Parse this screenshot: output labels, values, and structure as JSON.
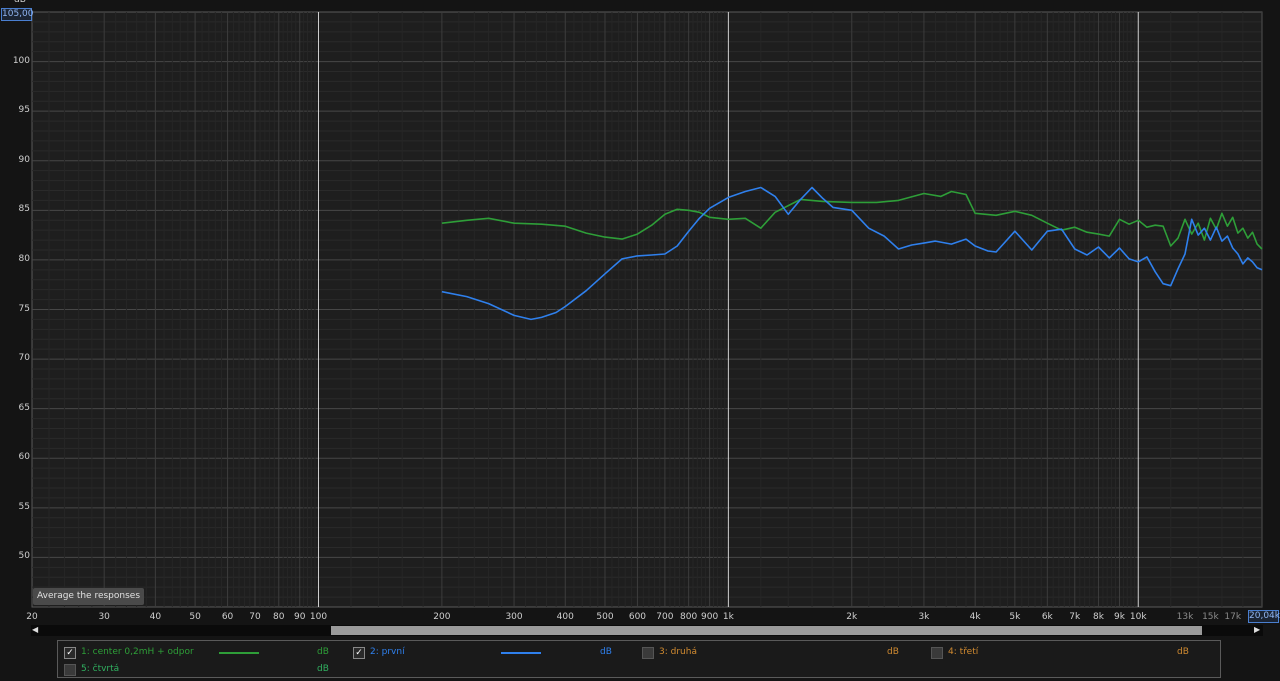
{
  "y_axis": {
    "unit": "dB",
    "max_value": "105,00",
    "tick_labels": [
      "100",
      "95",
      "90",
      "85",
      "80",
      "75",
      "70",
      "65",
      "60",
      "55",
      "50"
    ]
  },
  "x_axis": {
    "max_value": "20,04k",
    "tick_labels": [
      "20",
      "30",
      "40",
      "50",
      "60",
      "70",
      "80",
      "90",
      "100",
      "200",
      "300",
      "400",
      "500",
      "600",
      "700",
      "800",
      "900",
      "1k",
      "2k",
      "3k",
      "4k",
      "5k",
      "6k",
      "7k",
      "8k",
      "9k",
      "10k",
      "13k",
      "15k",
      "17k"
    ]
  },
  "buttons": {
    "average_label": "Average the responses"
  },
  "legend": {
    "items": [
      {
        "label": "1: center 0,2mH + odpor",
        "unit": "dB",
        "checked": true,
        "color": "#2e9e38"
      },
      {
        "label": "2: první",
        "unit": "dB",
        "checked": true,
        "color": "#2f80ed"
      },
      {
        "label": "3: druhá",
        "unit": "dB",
        "checked": false,
        "color": "#d08a30"
      },
      {
        "label": "4: třetí",
        "unit": "dB",
        "checked": false,
        "color": "#d08a30"
      },
      {
        "label": "5: čtvrtá",
        "unit": "dB",
        "checked": false,
        "color": "#30b060"
      }
    ]
  },
  "chart_data": {
    "type": "line",
    "x_scale": "log",
    "xlim": [
      20,
      20040
    ],
    "ylim": [
      45,
      105
    ],
    "grid": true,
    "series": [
      {
        "name": "1: center 0,2mH + odpor",
        "color": "#2e9e38",
        "x": [
          200,
          230,
          260,
          300,
          350,
          400,
          450,
          500,
          550,
          600,
          650,
          700,
          750,
          800,
          850,
          900,
          1000,
          1100,
          1200,
          1300,
          1500,
          1700,
          2000,
          2300,
          2600,
          3000,
          3300,
          3500,
          3800,
          4000,
          4500,
          5000,
          5500,
          6000,
          6500,
          7000,
          7500,
          8000,
          8500,
          9000,
          9500,
          10000,
          10500,
          11000,
          11500,
          12000,
          12500,
          13000,
          13500,
          14000,
          14500,
          15000,
          15500,
          16000,
          16500,
          17000,
          17500,
          18000,
          18500,
          19000,
          19500,
          20040
        ],
        "y": [
          83.7,
          84.0,
          84.2,
          83.7,
          83.6,
          83.4,
          82.7,
          82.3,
          82.1,
          82.6,
          83.5,
          84.6,
          85.1,
          85.0,
          84.8,
          84.3,
          84.1,
          84.2,
          83.2,
          84.8,
          86.1,
          85.9,
          85.8,
          85.8,
          86.0,
          86.7,
          86.4,
          86.9,
          86.6,
          84.7,
          84.5,
          84.9,
          84.5,
          83.7,
          83.0,
          83.3,
          82.8,
          82.6,
          82.4,
          84.1,
          83.6,
          84.0,
          83.3,
          83.5,
          83.4,
          81.4,
          82.2,
          84.1,
          82.6,
          83.7,
          82.0,
          84.2,
          83.1,
          84.7,
          83.4,
          84.3,
          82.7,
          83.2,
          82.2,
          82.8,
          81.6,
          81.1
        ]
      },
      {
        "name": "2: první",
        "color": "#2f80ed",
        "x": [
          200,
          230,
          260,
          300,
          330,
          350,
          380,
          400,
          450,
          500,
          550,
          600,
          650,
          700,
          750,
          800,
          850,
          900,
          1000,
          1100,
          1200,
          1300,
          1400,
          1500,
          1600,
          1700,
          1800,
          2000,
          2200,
          2400,
          2600,
          2800,
          3000,
          3200,
          3500,
          3800,
          4000,
          4300,
          4500,
          5000,
          5500,
          6000,
          6500,
          7000,
          7500,
          8000,
          8500,
          9000,
          9500,
          10000,
          10500,
          11000,
          11500,
          12000,
          12500,
          13000,
          13500,
          14000,
          14500,
          15000,
          15500,
          16000,
          16500,
          17000,
          17500,
          18000,
          18500,
          19000,
          19500,
          20040
        ],
        "y": [
          76.8,
          76.3,
          75.6,
          74.4,
          74.0,
          74.2,
          74.7,
          75.3,
          76.9,
          78.6,
          80.1,
          80.4,
          80.5,
          80.6,
          81.4,
          82.9,
          84.2,
          85.2,
          86.3,
          86.9,
          87.3,
          86.4,
          84.6,
          86.1,
          87.3,
          86.2,
          85.3,
          85.0,
          83.2,
          82.4,
          81.1,
          81.5,
          81.7,
          81.9,
          81.6,
          82.1,
          81.4,
          80.9,
          80.8,
          82.9,
          81.0,
          82.9,
          83.1,
          81.1,
          80.5,
          81.3,
          80.2,
          81.2,
          80.1,
          79.8,
          80.3,
          78.8,
          77.6,
          77.4,
          79.1,
          80.6,
          84.1,
          82.5,
          83.2,
          82.0,
          83.3,
          81.9,
          82.4,
          81.2,
          80.6,
          79.6,
          80.2,
          79.8,
          79.2,
          79.0
        ]
      }
    ]
  }
}
